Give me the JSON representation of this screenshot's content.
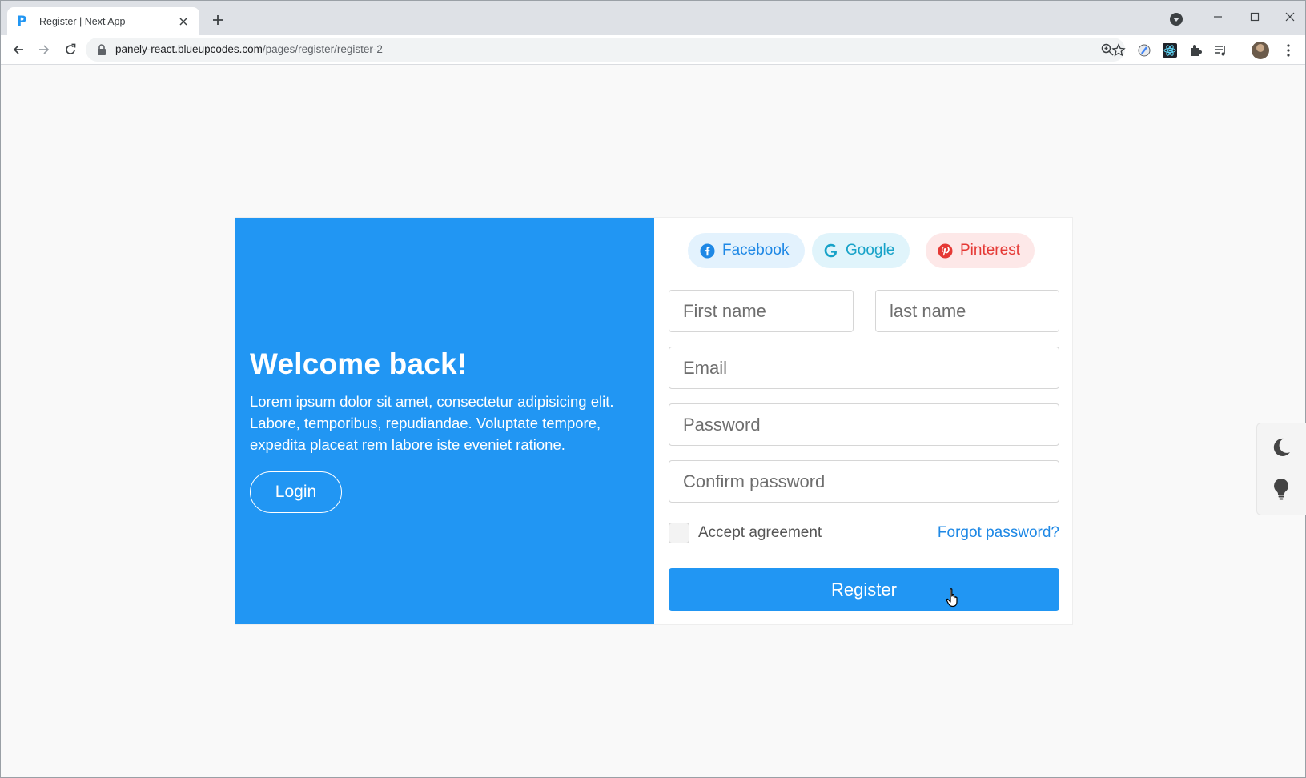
{
  "browser": {
    "tab_title": "Register | Next App",
    "url_host": "panely-react.blueupcodes.com",
    "url_path": "/pages/register/register-2"
  },
  "colors": {
    "primary": "#2196f3",
    "facebook": "#1e88e5",
    "google": "#17a2c8",
    "pinterest": "#e53935"
  },
  "welcome": {
    "title": "Welcome back!",
    "text": "Lorem ipsum dolor sit amet, consectetur adipisicing elit. Labore, temporibus, repudiandae. Voluptate tempore, expedita placeat rem labore iste eveniet ratione.",
    "login_label": "Login"
  },
  "social": {
    "facebook": "Facebook",
    "google": "Google",
    "pinterest": "Pinterest"
  },
  "form": {
    "first_name_placeholder": "First name",
    "last_name_placeholder": "last name",
    "email_placeholder": "Email",
    "password_placeholder": "Password",
    "confirm_placeholder": "Confirm password",
    "accept_label": "Accept agreement",
    "forgot_label": "Forgot password?",
    "register_label": "Register"
  },
  "icons": {
    "theme_dark": "moon-icon",
    "theme_light": "lightbulb-icon"
  }
}
